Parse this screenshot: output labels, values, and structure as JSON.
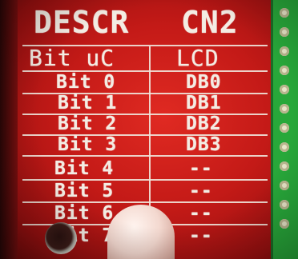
{
  "pcb": {
    "title_left": "DESCR",
    "title_right": "CN2",
    "header": {
      "col1": "Bit uC",
      "col2": "LCD"
    },
    "rows": [
      {
        "bit": "Bit 0",
        "lcd": "DB0"
      },
      {
        "bit": "Bit 1",
        "lcd": "DB1"
      },
      {
        "bit": "Bit 2",
        "lcd": "DB2"
      },
      {
        "bit": "Bit 3",
        "lcd": "DB3"
      },
      {
        "bit": "Bit 4",
        "lcd": "--"
      },
      {
        "bit": "Bit 5",
        "lcd": "--"
      },
      {
        "bit": "Bit 6",
        "lcd": "--"
      },
      {
        "bit": "Bit 7",
        "lcd": "--"
      }
    ]
  },
  "colors": {
    "board_red": "#c41a17",
    "silkscreen": "#f3ece3",
    "header_board_green": "#28a83a"
  }
}
